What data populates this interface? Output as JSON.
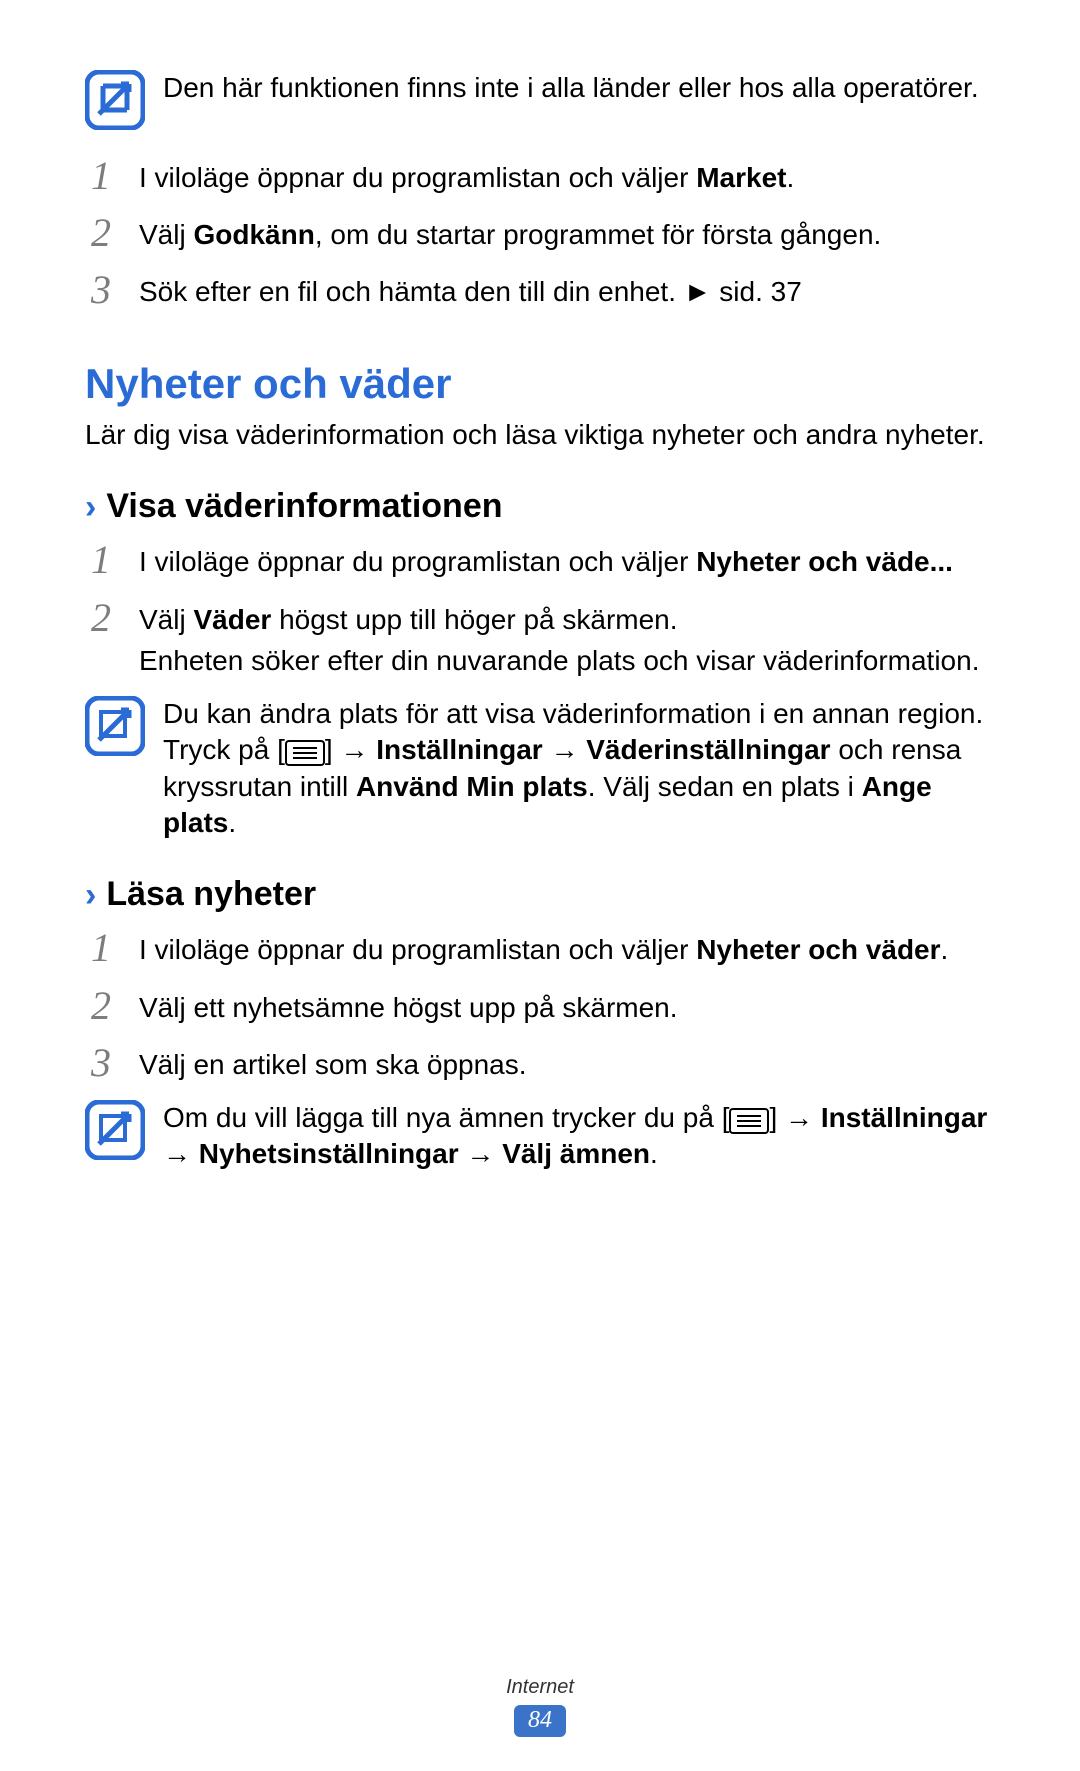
{
  "note1": {
    "text": "Den här funktionen finns inte i alla länder eller hos alla operatörer."
  },
  "list1": {
    "items": [
      {
        "num": "1",
        "pre": "I viloläge öppnar du programlistan och väljer ",
        "bold": "Market",
        "post": "."
      },
      {
        "num": "2",
        "pre": "Välj ",
        "bold": "Godkänn",
        "post": ", om du startar programmet för första gången."
      },
      {
        "num": "3",
        "pre": "Sök efter en fil och hämta den till din enhet. ",
        "tri": "►",
        "post": " sid. 37"
      }
    ]
  },
  "heading1": "Nyheter och väder",
  "intro1": "Lär dig visa väderinformation och läsa viktiga nyheter och andra nyheter.",
  "sub1": {
    "prefix": "›",
    "text": "Visa väderinformationen"
  },
  "list2": {
    "items": [
      {
        "num": "1",
        "pre": "I viloläge öppnar du programlistan och väljer ",
        "bold": "Nyheter och väde...",
        "post": ""
      },
      {
        "num": "2",
        "pre": "Välj ",
        "bold": "Väder",
        "post": " högst upp till höger på skärmen.",
        "extra": "Enheten söker efter din nuvarande plats och visar väderinformation."
      }
    ]
  },
  "note2": {
    "p1": "Du kan ändra plats för att visa väderinformation i en annan region. Tryck på [",
    "p2": "] → ",
    "b1": "Inställningar",
    "p3": " → ",
    "b2": "Väderinställningar",
    "p4": " och rensa kryssrutan intill ",
    "b3": "Använd Min plats",
    "p5": ". Välj sedan en plats i ",
    "b4": "Ange plats",
    "p6": "."
  },
  "sub2": {
    "prefix": "›",
    "text": "Läsa nyheter"
  },
  "list3": {
    "items": [
      {
        "num": "1",
        "pre": "I viloläge öppnar du programlistan och väljer ",
        "bold": "Nyheter och väder",
        "post": "."
      },
      {
        "num": "2",
        "pre": "Välj ett nyhetsämne högst upp på skärmen."
      },
      {
        "num": "3",
        "pre": "Välj en artikel som ska öppnas."
      }
    ]
  },
  "note3": {
    "p1": "Om du vill lägga till nya ämnen trycker du på [",
    "p2": "] → ",
    "b1": "Inställningar",
    "p3": " → ",
    "b2": "Nyhetsinställningar",
    "p4": " → ",
    "b3": "Välj ämnen",
    "p5": "."
  },
  "footer": {
    "section": "Internet",
    "page": "84"
  }
}
